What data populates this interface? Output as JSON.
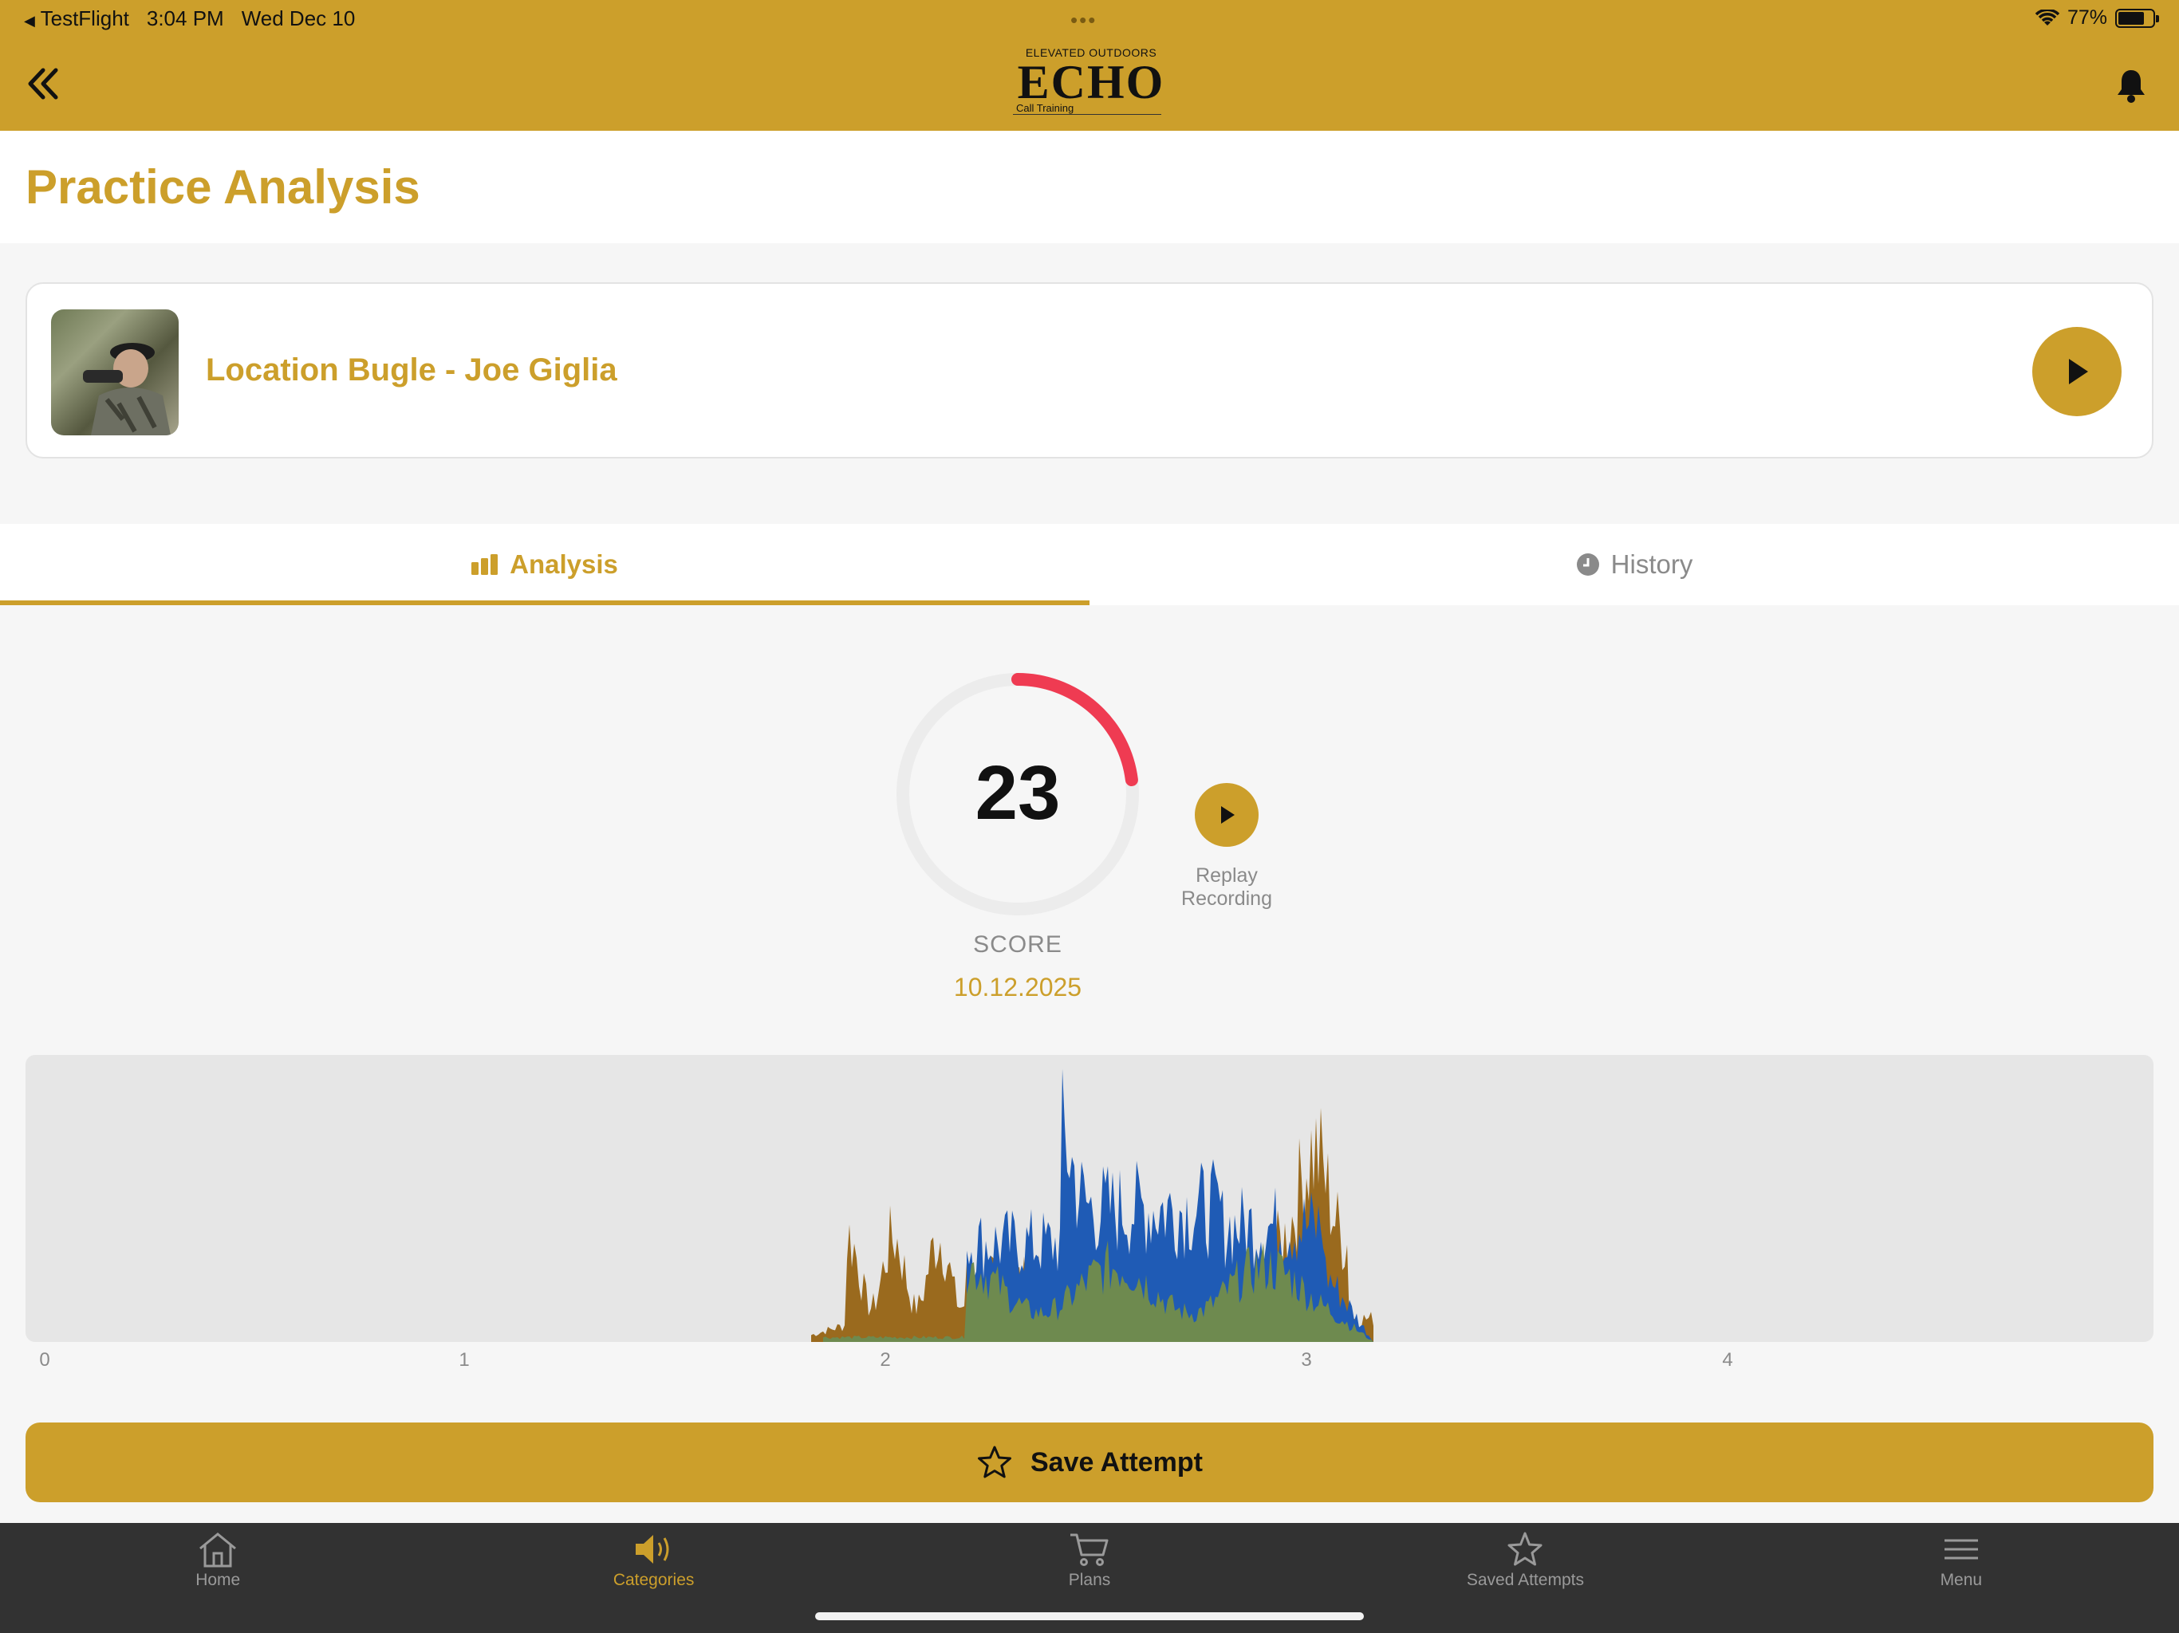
{
  "status_bar": {
    "back_app": "TestFlight",
    "time": "3:04 PM",
    "date": "Wed Dec 10",
    "battery": "77%",
    "battery_level": 0.77
  },
  "header": {
    "logo_top": "ELEVATED OUTDOORS",
    "logo_main": "ECHO",
    "logo_sub": "Call Training"
  },
  "page": {
    "title": "Practice Analysis"
  },
  "call": {
    "title": "Location Bugle - Joe Giglia"
  },
  "tabs": [
    {
      "label": "Analysis",
      "icon": "bar-chart-icon",
      "active": true
    },
    {
      "label": "History",
      "icon": "clock-icon",
      "active": false
    }
  ],
  "score": {
    "value": "23",
    "percent": 23,
    "label": "SCORE",
    "date": "10.12.2025",
    "replay_label_1": "Replay",
    "replay_label_2": "Recording"
  },
  "waveform": {
    "x_ticks": [
      "0",
      "1",
      "2",
      "3",
      "4"
    ],
    "colors": {
      "reference": "#9a6a1e",
      "attempt": "#1f5bb5",
      "overlap": "#6e8a4f"
    }
  },
  "save": {
    "label": "Save Attempt"
  },
  "nav": [
    {
      "label": "Home",
      "icon": "home-icon"
    },
    {
      "label": "Categories",
      "icon": "speaker-icon",
      "active": true
    },
    {
      "label": "Plans",
      "icon": "cart-icon"
    },
    {
      "label": "Saved Attempts",
      "icon": "star-icon"
    },
    {
      "label": "Menu",
      "icon": "menu-icon"
    }
  ],
  "colors": {
    "brand": "#cc9f2b",
    "score_arc": "#ef3b52",
    "nav_bg": "#323232"
  }
}
